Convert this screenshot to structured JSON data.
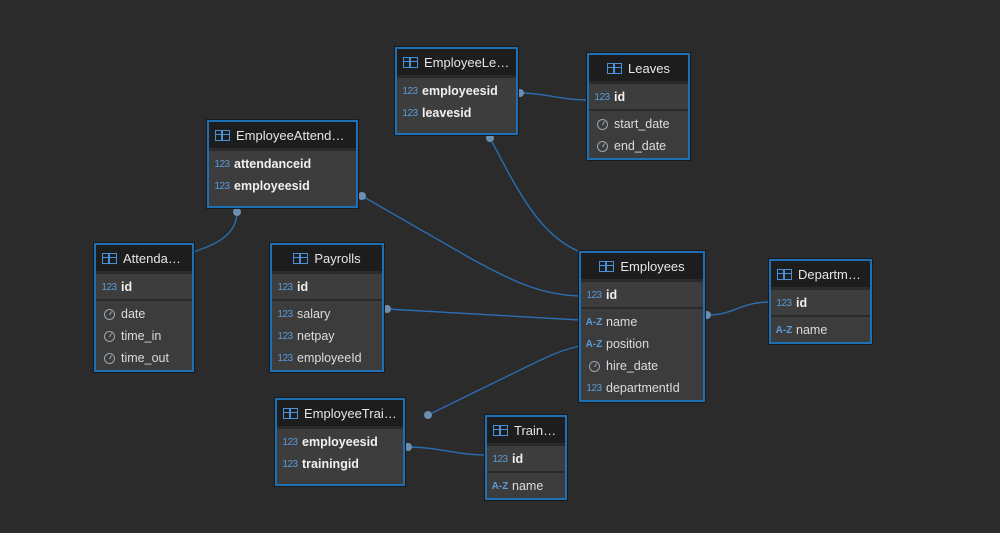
{
  "tables": {
    "employeeLeaves": {
      "name": "EmployeeLea...",
      "groups": [
        [
          {
            "t": "num",
            "n": "employeesid",
            "b": true
          },
          {
            "t": "num",
            "n": "leavesid",
            "b": true
          }
        ]
      ]
    },
    "leaves": {
      "name": "Leaves",
      "groups": [
        [
          {
            "t": "num",
            "n": "id",
            "b": true
          }
        ],
        [
          {
            "t": "clock",
            "n": "start_date"
          },
          {
            "t": "clock",
            "n": "end_date"
          }
        ]
      ]
    },
    "employeeAttendances": {
      "name": "EmployeeAttendan...",
      "groups": [
        [
          {
            "t": "num",
            "n": "attendanceid",
            "b": true
          },
          {
            "t": "num",
            "n": "employeesid",
            "b": true
          }
        ]
      ]
    },
    "attendances": {
      "name": "Attendances",
      "groups": [
        [
          {
            "t": "num",
            "n": "id",
            "b": true
          }
        ],
        [
          {
            "t": "clock",
            "n": "date"
          },
          {
            "t": "clock",
            "n": "time_in"
          },
          {
            "t": "clock",
            "n": "time_out"
          }
        ]
      ]
    },
    "payrolls": {
      "name": "Payrolls",
      "groups": [
        [
          {
            "t": "num",
            "n": "id",
            "b": true
          }
        ],
        [
          {
            "t": "num",
            "n": "salary"
          },
          {
            "t": "num",
            "n": "netpay"
          },
          {
            "t": "num",
            "n": "employeeId"
          }
        ]
      ]
    },
    "employees": {
      "name": "Employees",
      "groups": [
        [
          {
            "t": "num",
            "n": "id",
            "b": true
          }
        ],
        [
          {
            "t": "az",
            "n": "name"
          },
          {
            "t": "az",
            "n": "position"
          },
          {
            "t": "clock",
            "n": "hire_date"
          },
          {
            "t": "num",
            "n": "departmentId"
          }
        ]
      ]
    },
    "departments": {
      "name": "Departments",
      "groups": [
        [
          {
            "t": "num",
            "n": "id",
            "b": true
          }
        ],
        [
          {
            "t": "az",
            "n": "name"
          }
        ]
      ]
    },
    "employeeTrainings": {
      "name": "EmployeeTraini...",
      "groups": [
        [
          {
            "t": "num",
            "n": "employeesid",
            "b": true
          },
          {
            "t": "num",
            "n": "trainingid",
            "b": true
          }
        ]
      ]
    },
    "trainings": {
      "name": "Trainings",
      "groups": [
        [
          {
            "t": "num",
            "n": "id",
            "b": true
          }
        ],
        [
          {
            "t": "az",
            "n": "name"
          }
        ]
      ]
    }
  },
  "icons": {
    "num": "123",
    "az": "A-Z"
  },
  "colors": {
    "background": "#2b2b2b",
    "border": "#1f6fb5",
    "header": "#1d1d1d",
    "body": "#3c3c3c",
    "link": "#2a6db0",
    "dot": "#6a8fb3"
  }
}
